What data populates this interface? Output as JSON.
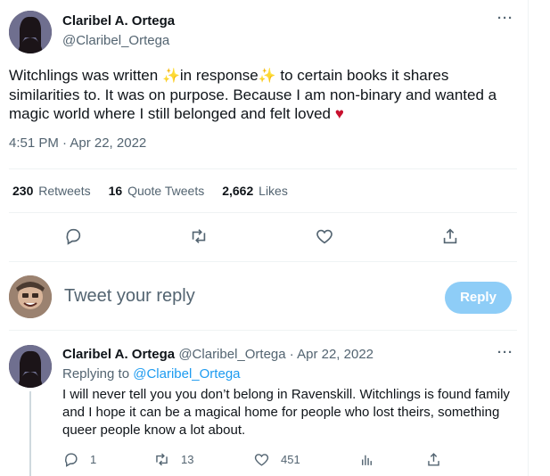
{
  "main_tweet": {
    "name": "Claribel A. Ortega",
    "handle": "@Claribel_Ortega",
    "text_part1": "Witchlings was written ",
    "sparkle": "✨",
    "text_part2": "in response",
    "text_part3": " to certain books it shares similarities to. It was on purpose. Because I am non-binary and wanted a magic world where I still belonged and felt loved ",
    "heart": "♥",
    "timestamp": "4:51 PM · Apr 22, 2022",
    "more": "···"
  },
  "stats": {
    "retweets_count": "230",
    "retweets_label": "Retweets",
    "quotes_count": "16",
    "quotes_label": "Quote Tweets",
    "likes_count": "2,662",
    "likes_label": "Likes"
  },
  "actions": {
    "icons": [
      "reply-icon",
      "retweet-icon",
      "like-icon",
      "share-icon"
    ]
  },
  "composer": {
    "placeholder": "Tweet your reply",
    "button_label": "Reply"
  },
  "reply_tweet": {
    "name": "Claribel A. Ortega",
    "meta": "@Claribel_Ortega · Apr 22, 2022",
    "replying_prefix": "Replying to ",
    "replying_handle": "@Claribel_Ortega",
    "text": "I will never tell you you don’t belong in Ravenskill. Witchlings is found family and I hope it can be a magical home for people who lost theirs, something queer people know a lot about.",
    "reply_count": "1",
    "retweet_count": "13",
    "like_count": "451",
    "more": "···"
  },
  "colors": {
    "accent": "#1d9bf0",
    "reply_button_disabled": "#8ecdf7",
    "secondary_text": "#536471",
    "heart": "#c8102e",
    "sparkle": "#f5b400"
  }
}
